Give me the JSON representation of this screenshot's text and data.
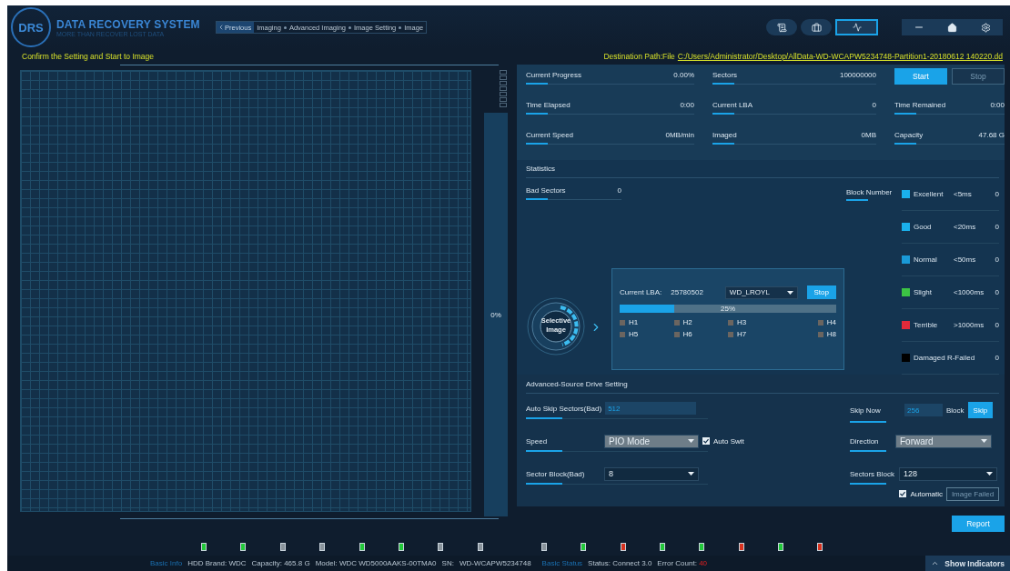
{
  "header": {
    "logo": {
      "initials": "DRS",
      "title": "DATA RECOVERY SYSTEM",
      "subtitle": "MORE THAN RECOVER LOST DATA"
    },
    "breadcrumb": {
      "back": "Previous",
      "steps": [
        "Imaging",
        "Advanced Imaging",
        "Image Setting",
        "Image"
      ]
    },
    "toolbar": [
      {
        "kind": "report",
        "selected": false
      },
      {
        "kind": "tools",
        "selected": false
      },
      {
        "kind": "chart",
        "selected": true
      }
    ]
  },
  "instruction": "Confirm the Setting and Start to Image",
  "destination": {
    "label": "Destination Path:File",
    "path": "C:/Users/Administrator/Desktop/AllData-WD-WCAPW5234748-Partition1-20180612 140220.dd"
  },
  "overall_progress": {
    "reading": "0%"
  },
  "stats": [
    {
      "label": "Current Progress",
      "value": "0.00%"
    },
    {
      "label": "Sectors",
      "value": "100000000"
    },
    {
      "label": "Time Elapsed",
      "value": "0:00"
    },
    {
      "label": "Current LBA",
      "value": "0"
    },
    {
      "label": "Time Remained",
      "value": "0:00"
    },
    {
      "label": "Current Speed",
      "value": "0MB/min"
    },
    {
      "label": "Imaged",
      "value": "0MB"
    },
    {
      "label": "Capacity",
      "value": "47.68 G"
    }
  ],
  "actions": [
    {
      "label": "Start",
      "disabled": false
    },
    {
      "label": "Stop",
      "disabled": true
    }
  ],
  "statistics": {
    "title": "Statistics",
    "bad_sectors": {
      "label": "Bad Sectors",
      "value": "0"
    },
    "block_number": "Block Number",
    "legend": [
      {
        "name": "Excellent",
        "range": "<5ms",
        "count": "0",
        "color": "#1ab0ec"
      },
      {
        "name": "Good",
        "range": "<20ms",
        "count": "0",
        "color": "#1ab0ec"
      },
      {
        "name": "Normal",
        "range": "<50ms",
        "count": "0",
        "color": "#1a9ad8"
      },
      {
        "name": "Slight",
        "range": "<1000ms",
        "count": "0",
        "color": "#3cc444"
      },
      {
        "name": "Terrible",
        "range": ">1000ms",
        "count": "0",
        "color": "#e02a3a"
      },
      {
        "name": "Damaged R-Failed",
        "count": "0",
        "color": "#000000"
      }
    ]
  },
  "selective": {
    "label": "Selective Image",
    "lba_label": "Current LBA:",
    "lba_value": "25780502",
    "drive": "WD_LROYL",
    "stop": "Stop",
    "progress": {
      "level": 0.25,
      "reading": "25%"
    },
    "heads": [
      {
        "label": "H1",
        "checked": false
      },
      {
        "label": "H2",
        "checked": false
      },
      {
        "label": "H3",
        "checked": false
      },
      {
        "label": "H4",
        "checked": false
      },
      {
        "label": "H5",
        "checked": false
      },
      {
        "label": "H6",
        "checked": false
      },
      {
        "label": "H7",
        "checked": false
      },
      {
        "label": "H8",
        "checked": false
      }
    ]
  },
  "advanced": {
    "title": "Advanced-Source Drive Setting",
    "auto_skip": {
      "label": "Auto Skip Sectors(Bad)",
      "value": "512"
    },
    "skip_now": {
      "label": "Skip Now",
      "value": "256",
      "unit": "Block",
      "button": "Skip"
    },
    "speed": {
      "label": "Speed",
      "value": "PIO Mode",
      "auto_switch": {
        "label": "Auto Swit",
        "checked": true
      }
    },
    "direction": {
      "label": "Direction",
      "value": "Forward"
    },
    "sector_block": {
      "label": "Sector Block(Bad)",
      "value": "8"
    },
    "sectors_block": {
      "label": "Sectors Block",
      "value": "128"
    },
    "automatic": {
      "label": "Automatic",
      "checked": true
    },
    "image_failed": {
      "label": "Image Failed",
      "disabled": true
    }
  },
  "report": "Report",
  "indicators": [
    {
      "color": "#22c93a"
    },
    {
      "color": "#22c93a"
    },
    {
      "color": "#8a949c"
    },
    {
      "color": "#8a949c"
    },
    {
      "color": "#22c93a"
    },
    {
      "color": "#22c93a"
    },
    {
      "color": "#8a949c"
    },
    {
      "color": "#8a949c"
    },
    {
      "color": "#8a949c"
    },
    {
      "color": "#22c93a"
    },
    {
      "color": "#d8321f"
    },
    {
      "color": "#22c93a"
    },
    {
      "color": "#22c93a"
    },
    {
      "color": "#d8321f"
    },
    {
      "color": "#22c93a"
    },
    {
      "color": "#d8321f"
    }
  ],
  "status_bar": {
    "basic_info": "Basic Info",
    "info": [
      "HDD Brand: WDC",
      "Capacity: 465.8 G",
      "Model: WDC WD5000AAKS-00TMA0",
      "SN:",
      "WD-WCAPW5234748"
    ],
    "basic_status": "Basic Status",
    "status": "Status: Connect 3.0",
    "error_label": "Error Count:",
    "error_value": "40",
    "show_indicators": "Show Indicators"
  }
}
